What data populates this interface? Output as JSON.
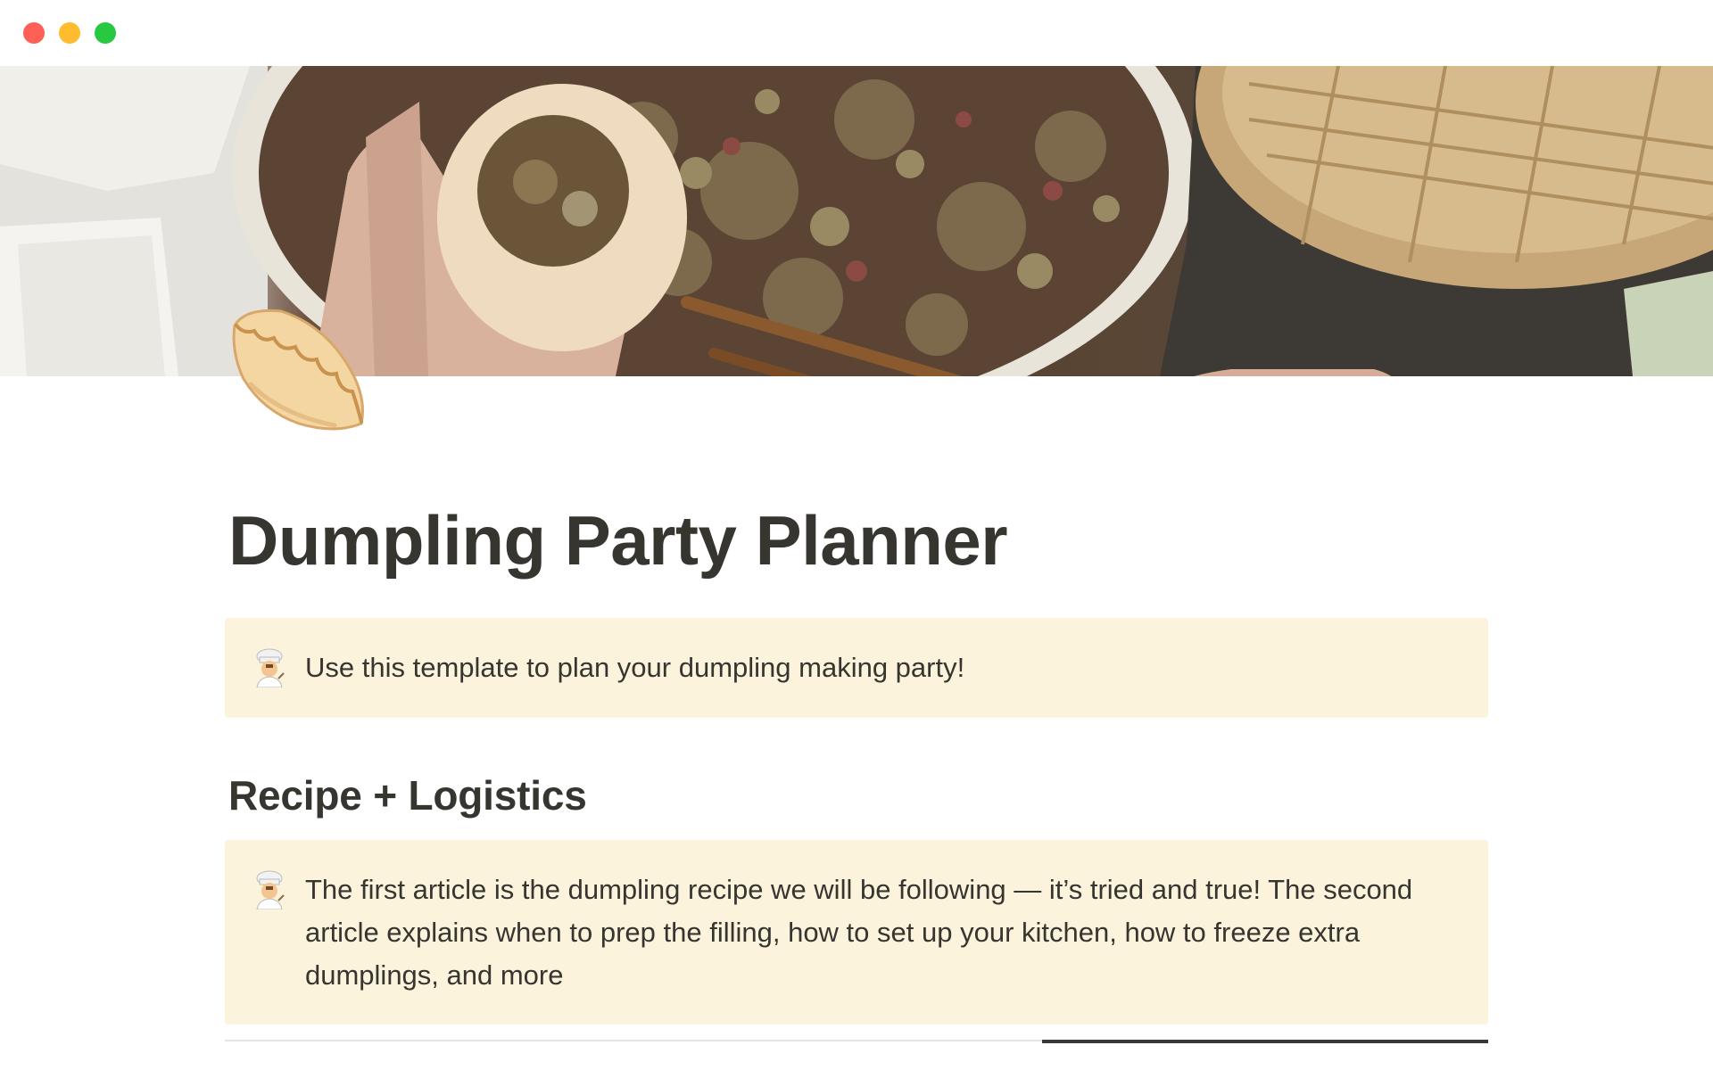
{
  "window": {
    "controls": [
      "close",
      "minimize",
      "maximize"
    ],
    "colors": {
      "close": "#fe5f57",
      "minimize": "#febc2e",
      "maximize": "#28c840"
    }
  },
  "page": {
    "icon": "dumpling-icon",
    "title": "Dumpling Party Planner"
  },
  "callouts": [
    {
      "icon": "cook-icon",
      "text": "Use this template to plan your dumpling making party!"
    },
    {
      "icon": "cook-icon",
      "text": "The first article is the dumpling recipe we will be following — it’s tried and true! The second article explains when to prep the filling, how to set up your kitchen, how to freeze extra dumplings, and more"
    }
  ],
  "sections": [
    {
      "heading": "Recipe + Logistics"
    }
  ],
  "colors": {
    "callout_bg": "#fbf3db",
    "text": "#37352f"
  }
}
